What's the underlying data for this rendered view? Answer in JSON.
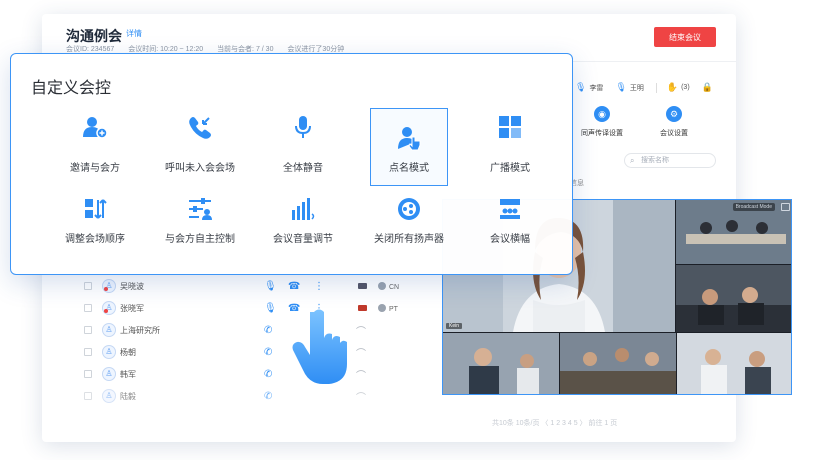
{
  "meeting": {
    "title": "沟通例会",
    "detail_link": "详情",
    "meeting_id": "会议ID: 234567",
    "meeting_time": "会议时间: 10:20 ~ 12:20",
    "attendance": "当前与会者: 7 / 30",
    "elapsed": "会议进行了30分钟",
    "end_button": "结束会议"
  },
  "top_bar": {
    "item1": "李雷",
    "item2": "王明",
    "hand_count": "(3)"
  },
  "side_tools": {
    "sync_settings": "同声传译设置",
    "meeting_settings": "会议设置"
  },
  "search": {
    "placeholder": "搜索名称"
  },
  "attendee_header": "信息",
  "participants": [
    {
      "name": "吴晓波",
      "tag": "CN",
      "active": true
    },
    {
      "name": "张晓军",
      "tag": "PT",
      "active": true
    },
    {
      "name": "上海研究所",
      "tag": "",
      "active": false
    },
    {
      "name": "杨朝",
      "tag": "",
      "active": false
    },
    {
      "name": "韩军",
      "tag": "",
      "active": false
    },
    {
      "name": "陆毅",
      "tag": "",
      "active": false
    }
  ],
  "pager": "共10条  10条/页  〈 1 2 3 4 5 〉  前往 1 页",
  "video": {
    "broadcast_label": "Broadcast Mode",
    "speaker_label": "Kein"
  },
  "panel": {
    "title": "自定义会控",
    "row1": [
      {
        "label": "邀请与会方",
        "icon": "invite-user-icon"
      },
      {
        "label": "呼叫未入会会场",
        "icon": "call-incoming-icon"
      },
      {
        "label": "全体静音",
        "icon": "microphone-icon"
      },
      {
        "label": "点名模式",
        "icon": "roll-call-icon",
        "selected": true
      },
      {
        "label": "广播模式",
        "icon": "broadcast-grid-icon"
      }
    ],
    "row2": [
      {
        "label": "调整会场顺序",
        "icon": "reorder-icon"
      },
      {
        "label": "与会方自主控制",
        "icon": "self-control-icon"
      },
      {
        "label": "会议音量调节",
        "icon": "volume-bars-icon"
      },
      {
        "label": "关闭所有扬声器",
        "icon": "speaker-off-icon"
      },
      {
        "label": "会议横幅",
        "icon": "banner-icon"
      }
    ]
  },
  "colors": {
    "accent": "#2f8ef4",
    "danger": "#ef4444",
    "panel_border": "#3d95f6"
  }
}
